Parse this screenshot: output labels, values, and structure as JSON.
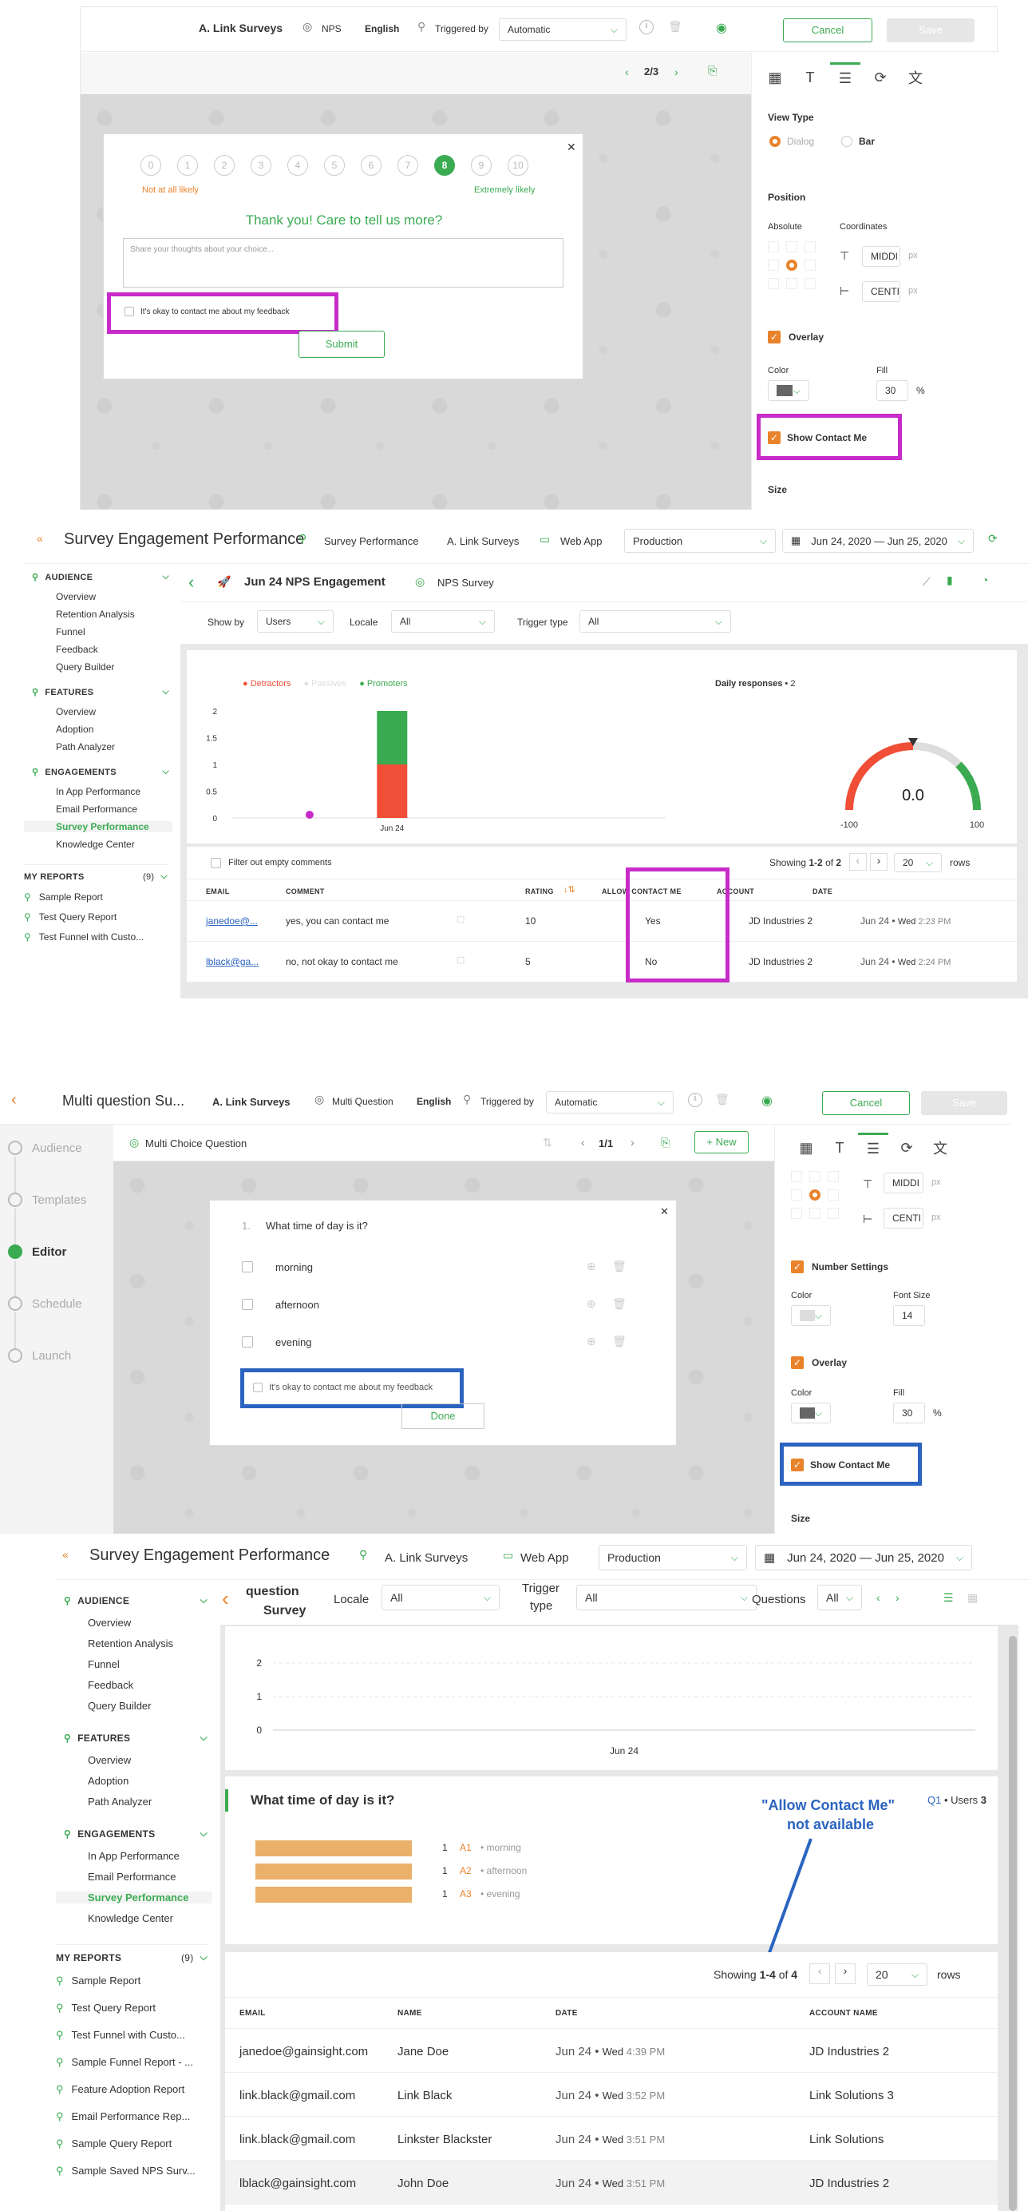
{
  "colors": {
    "accent": "#3bab52",
    "orange": "#e8832b",
    "magenta": "#c72bc9",
    "blue": "#2b64c0",
    "red": "#f04e37"
  },
  "s1": {
    "survey_name": "A. Link Surveys",
    "type": "NPS",
    "language": "English",
    "triggered_by": "Triggered by",
    "trigger_value": "Automatic",
    "cancel": "Cancel",
    "save": "Save",
    "pager": "2/3",
    "scale": [
      "0",
      "1",
      "2",
      "3",
      "4",
      "5",
      "6",
      "7",
      "8",
      "9",
      "10"
    ],
    "selected": "8",
    "low_label": "Not at all likely",
    "high_label": "Extremely likely",
    "thanks": "Thank you! Care to tell us more?",
    "textarea_placeholder": "Share your thoughts about your choice...",
    "contact": "It's okay to contact me about my feedback",
    "submit": "Submit",
    "panel": {
      "view_type": "View Type",
      "dialog": "Dialog",
      "bar": "Bar",
      "position": "Position",
      "absolute": "Absolute",
      "coordinates": "Coordinates",
      "coord1": "MIDDI",
      "coord2": "CENTI",
      "px": "px",
      "overlay": "Overlay",
      "color": "Color",
      "fill": "Fill",
      "fill_value": "30",
      "pct": "%",
      "show_contact": "Show Contact Me",
      "size": "Size"
    }
  },
  "s2": {
    "title": "Survey Engagement Performance",
    "crumb1": "Survey Performance",
    "crumb2": "A. Link Surveys",
    "crumb3": "Web App",
    "env": "Production",
    "date_range": "Jun 24, 2020 — Jun 25, 2020",
    "survey_title": "Jun 24 NPS Engagement",
    "survey_type": "NPS Survey",
    "show_by": "Show by",
    "show_by_val": "Users",
    "locale": "Locale",
    "locale_val": "All",
    "trigger_type": "Trigger type",
    "trigger_val": "All",
    "sidebar": {
      "audience": "AUDIENCE",
      "audience_items": [
        "Overview",
        "Retention Analysis",
        "Funnel",
        "Feedback",
        "Query Builder"
      ],
      "features": "FEATURES",
      "features_items": [
        "Overview",
        "Adoption",
        "Path Analyzer"
      ],
      "engagements": "ENGAGEMENTS",
      "engagements_items": [
        "In App Performance",
        "Email Performance",
        "Survey Performance",
        "Knowledge Center"
      ],
      "my_reports": "MY REPORTS",
      "my_reports_count": "(9)",
      "reports": [
        "Sample Report",
        "Test Query Report",
        "Test Funnel with Custo..."
      ]
    },
    "legend": [
      "Detractors",
      "Passives",
      "Promoters"
    ],
    "daily": "Daily responses",
    "daily_count": "2",
    "gauge_value": "0.0",
    "gauge_min": "-100",
    "gauge_max": "100",
    "filter_empty": "Filter out empty comments",
    "showing": "Showing",
    "showing_range": "1-2",
    "of": "of",
    "total": "2",
    "rows_val": "20",
    "rows": "rows",
    "cols": [
      "EMAIL",
      "COMMENT",
      "RATING",
      "ALLOW CONTACT ME",
      "ACCOUNT",
      "DATE"
    ],
    "rows_data": [
      {
        "email": "janedoe@...",
        "comment": "yes, you can contact me",
        "rating": "10",
        "allow": "Yes",
        "account": "JD Industries 2",
        "date": "Jun 24",
        "day": "Wed",
        "time": "2:23 PM"
      },
      {
        "email": "lblack@ga...",
        "comment": "no, not okay to contact me",
        "rating": "5",
        "allow": "No",
        "account": "JD Industries 2",
        "date": "Jun 24",
        "day": "Wed",
        "time": "2:24 PM"
      }
    ]
  },
  "chart_data": [
    {
      "type": "bar",
      "categories": [
        "Jun 24"
      ],
      "series": [
        {
          "name": "Detractors",
          "values": [
            1
          ]
        },
        {
          "name": "Passives",
          "values": [
            0
          ]
        },
        {
          "name": "Promoters",
          "values": [
            1
          ]
        }
      ],
      "y_ticks": [
        "0",
        "0.5",
        "1",
        "1.5",
        "2"
      ],
      "ylim": [
        0,
        2
      ],
      "stacked": true
    },
    {
      "type": "bar",
      "categories": [
        "Jun 24"
      ],
      "y_ticks": [
        "0",
        "1",
        "2"
      ],
      "ylim": [
        0,
        2
      ]
    }
  ],
  "s3": {
    "title": "Multi question Su...",
    "survey_name": "A. Link Surveys",
    "type": "Multi Question",
    "language": "English",
    "triggered_by": "Triggered by",
    "trigger_value": "Automatic",
    "cancel": "Cancel",
    "save": "Save",
    "steps": [
      "Audience",
      "Templates",
      "Editor",
      "Schedule",
      "Launch"
    ],
    "question_type": "Multi Choice Question",
    "pager": "1/1",
    "new": "+ New",
    "q_num": "1.",
    "question": "What time of day is it?",
    "options": [
      "morning",
      "afternoon",
      "evening"
    ],
    "contact": "It's okay to contact me about my feedback",
    "done": "Done",
    "panel": {
      "coord1": "MIDDI",
      "coord2": "CENTI",
      "px": "px",
      "number_settings": "Number Settings",
      "color": "Color",
      "font_size": "Font Size",
      "font_size_val": "14",
      "overlay": "Overlay",
      "fill": "Fill",
      "fill_value": "30",
      "pct": "%",
      "show_contact": "Show Contact Me",
      "size": "Size"
    }
  },
  "s4": {
    "title": "Survey Engagement Performance",
    "crumb2": "A. Link Surveys",
    "crumb3": "Web App",
    "env": "Production",
    "date_range": "Jun 24, 2020 — Jun 25, 2020",
    "survey_title_a": "question",
    "survey_title_b": "Survey",
    "locale": "Locale",
    "locale_val": "All",
    "trigger_a": "Trigger",
    "trigger_b": "type",
    "trigger_val": "All",
    "questions": "Questions",
    "questions_val": "All",
    "sidebar": {
      "audience": "AUDIENCE",
      "audience_items": [
        "Overview",
        "Retention Analysis",
        "Funnel",
        "Feedback",
        "Query Builder"
      ],
      "features": "FEATURES",
      "features_items": [
        "Overview",
        "Adoption",
        "Path Analyzer"
      ],
      "engagements": "ENGAGEMENTS",
      "engagements_items": [
        "In App Performance",
        "Email Performance",
        "Survey Performance",
        "Knowledge Center"
      ],
      "my_reports": "MY REPORTS",
      "my_reports_count": "(9)",
      "reports": [
        "Sample Report",
        "Test Query Report",
        "Test Funnel with Custo...",
        "Sample Funnel Report - ...",
        "Feature Adoption Report",
        "Email Performance Rep...",
        "Sample Query Report",
        "Sample Saved NPS Surv..."
      ]
    },
    "x_label": "Jun 24",
    "question": "What time of day is it?",
    "q_badge": "Q1",
    "q_users": "Users",
    "q_users_count": "3",
    "answers": [
      {
        "count": "1",
        "code": "A1",
        "label": "morning"
      },
      {
        "count": "1",
        "code": "A2",
        "label": "afternoon"
      },
      {
        "count": "1",
        "code": "A3",
        "label": "evening"
      }
    ],
    "note1": "\"Allow Contact Me\"",
    "note2": "not available",
    "showing": "Showing",
    "showing_range": "1-4",
    "of": "of",
    "total": "4",
    "rows_val": "20",
    "rows": "rows",
    "cols": [
      "EMAIL",
      "NAME",
      "DATE",
      "ACCOUNT NAME"
    ],
    "rows_data": [
      {
        "email": "janedoe@gainsight.com",
        "name": "Jane Doe",
        "date": "Jun 24",
        "day": "Wed",
        "time": "4:39 PM",
        "account": "JD Industries 2"
      },
      {
        "email": "link.black@gmail.com",
        "name": "Link Black",
        "date": "Jun 24",
        "day": "Wed",
        "time": "3:52 PM",
        "account": "Link Solutions 3"
      },
      {
        "email": "link.black@gmail.com",
        "name": "Linkster Blackster",
        "date": "Jun 24",
        "day": "Wed",
        "time": "3:51 PM",
        "account": "Link Solutions"
      },
      {
        "email": "lblack@gainsight.com",
        "name": "John Doe",
        "date": "Jun 24",
        "day": "Wed",
        "time": "3:51 PM",
        "account": "JD Industries 2"
      }
    ]
  }
}
